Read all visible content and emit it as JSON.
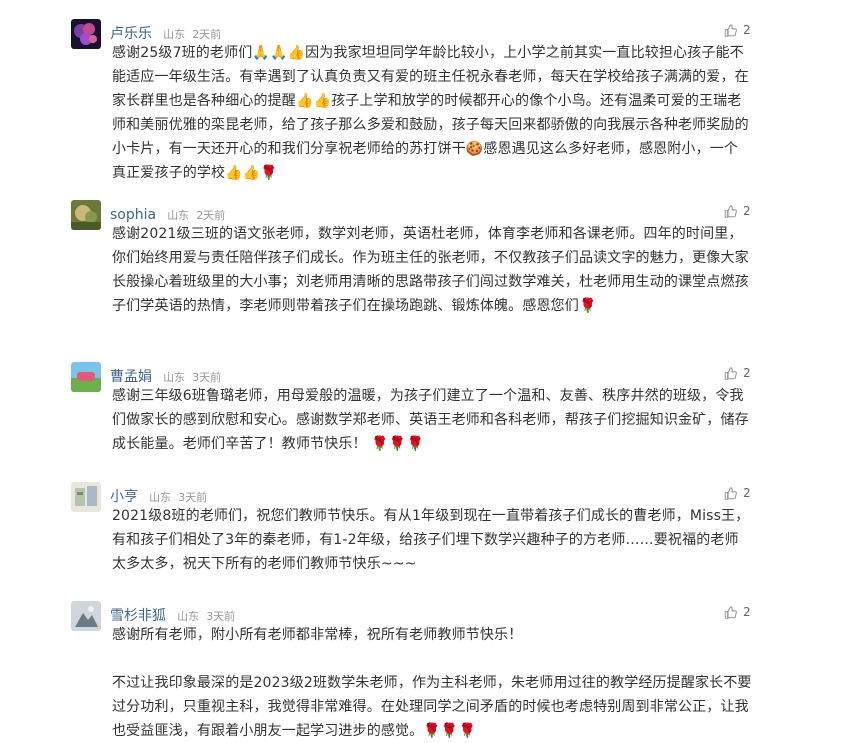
{
  "comments": [
    {
      "author": "卢乐乐",
      "location": "山东",
      "time": "2天前",
      "likes": "2",
      "paragraphs": [
        "感谢25级7班的老师们🙏🙏👍因为我家坦坦同学年龄比较小，上小学之前其实一直比较担心孩子能不能适应一年级生活。有幸遇到了认真负责又有爱的班主任祝永春老师，每天在学校给孩子满满的爱，在家长群里也是各种细心的提醒👍👍孩子上学和放学的时候都开心的像个小鸟。还有温柔可爱的王瑞老师和美丽优雅的栾昆老师，给了孩子那么多爱和鼓励，孩子每天回来都骄傲的向我展示各种老师奖励的小卡片，有一天还开心的和我们分享祝老师给的苏打饼干🍪感恩遇见这么多好老师，感恩附小，一个真正爱孩子的学校👍👍🌹"
      ]
    },
    {
      "author": "sophia",
      "location": "山东",
      "time": "2天前",
      "likes": "2",
      "paragraphs": [
        "感谢2021级三班的语文张老师，数学刘老师，英语杜老师，体育李老师和各课老师。四年的时间里，你们始终用爱与责任陪伴孩子们成长。作为班主任的张老师，不仅教孩子们品读文字的魅力，更像大家长般操心着班级里的大小事；刘老师用清晰的思路带孩子们闯过数学难关，杜老师用生动的课堂点燃孩子们学英语的热情，李老师则带着孩子们在操场跑跳、锻炼体魄。感恩您们🌹"
      ]
    },
    {
      "author": "曹孟娟",
      "location": "山东",
      "time": "3天前",
      "likes": "2",
      "paragraphs": [
        "感谢三年级6班鲁璐老师，用母爱般的温暖，为孩子们建立了一个温和、友善、秩序井然的班级，令我们做家长的感到欣慰和安心。感谢数学郑老师、英语王老师和各科老师，帮孩子们挖掘知识金矿，储存成长能量。老师们辛苦了！教师节快乐！ 🌹🌹🌹"
      ]
    },
    {
      "author": "小亨",
      "location": "山东",
      "time": "3天前",
      "likes": "2",
      "paragraphs": [
        "2021级8班的老师们，祝您们教师节快乐。有从1年级到现在一直带着孩子们成长的曹老师，Miss王，有和孩子们相处了3年的秦老师，有1-2年级，给孩子们埋下数学兴趣种子的方老师……要祝福的老师太多太多，祝天下所有的老师们教师节快乐~~~"
      ]
    },
    {
      "author": "雪杉非狐",
      "location": "山东",
      "time": "3天前",
      "likes": "2",
      "paragraphs": [
        "感谢所有老师，附小所有老师都非常棒，祝所有老师教师节快乐！",
        "不过让我印象最深的是2023级2班数学朱老师，作为主科老师，朱老师用过往的教学经历提醒家长不要过分功利，只重视主科，我觉得非常难得。在处理同学之间矛盾的时候也考虑特别周到非常公正，让我也受益匪浅，有跟着小朋友一起学习进步的感觉。🌹🌹🌹"
      ]
    }
  ],
  "like_icon": "thumbs-up-icon",
  "colors": {
    "author": "#40668c",
    "meta": "#999999",
    "text": "#333333"
  }
}
